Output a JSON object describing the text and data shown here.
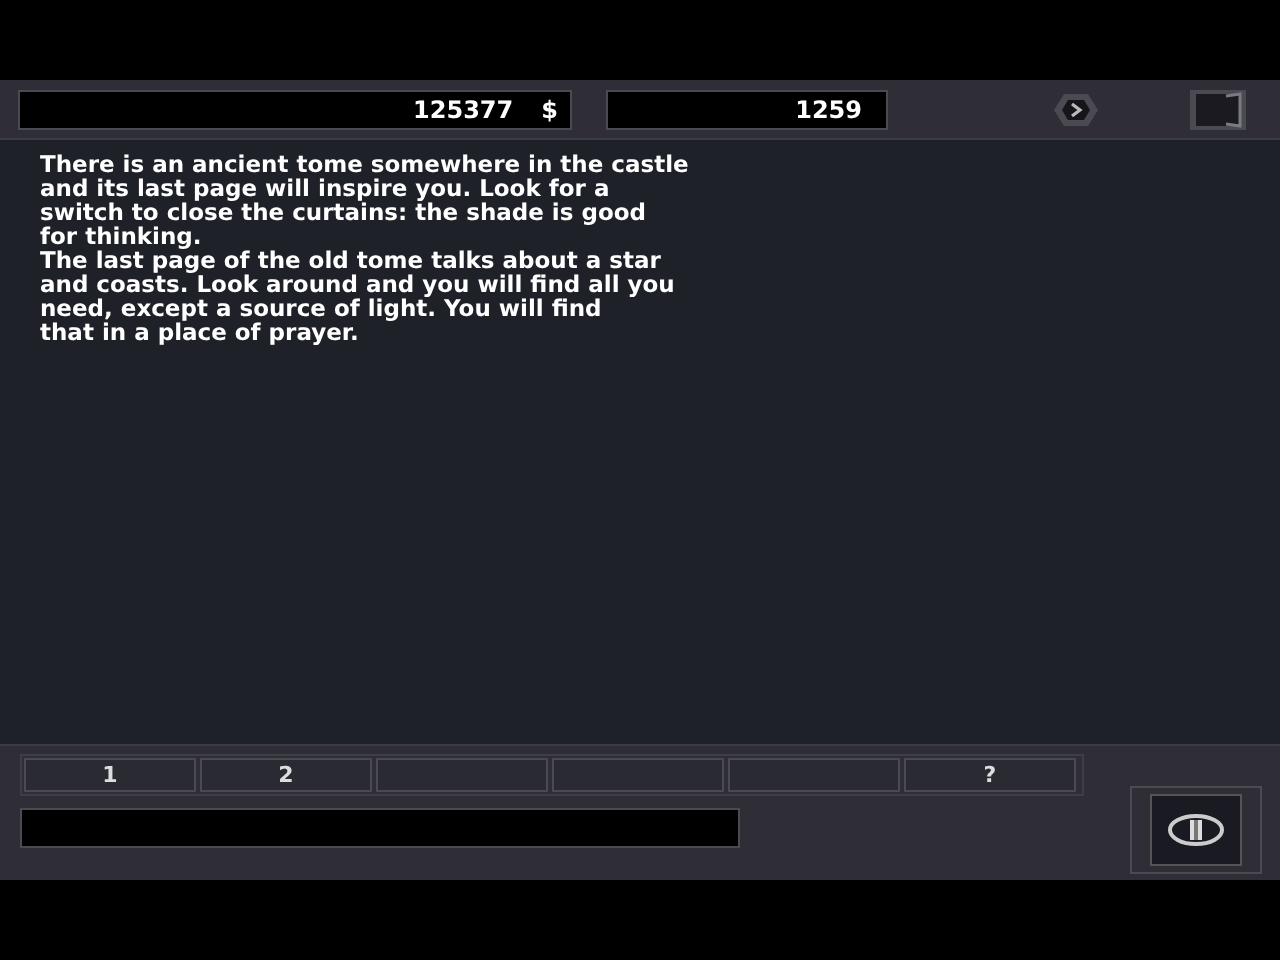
{
  "top_bar": {
    "money": "125377",
    "currency_symbol": "$",
    "counter": "1259"
  },
  "message": {
    "paragraphs": [
      "There is an ancient tome somewhere in the castle\nand its last page will inspire you. Look for a\nswitch to close the curtains: the shade is good\nfor thinking.",
      "The last page of the old tome talks about a star\nand coasts. Look around and you will find all you\nneed, except a source of light. You will find\nthat in a place of prayer."
    ]
  },
  "slots": [
    {
      "kind": "labeled",
      "label": "1"
    },
    {
      "kind": "labeled",
      "label": "2"
    },
    {
      "kind": "empty"
    },
    {
      "kind": "empty"
    },
    {
      "kind": "empty"
    },
    {
      "kind": "labeled",
      "label": "?"
    }
  ]
}
